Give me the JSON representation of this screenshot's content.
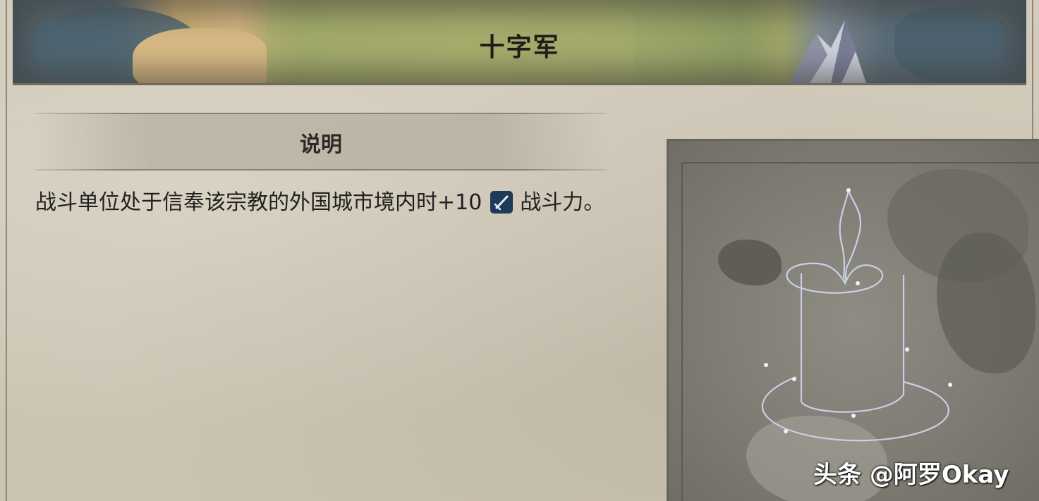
{
  "header": {
    "title": "十字军"
  },
  "section": {
    "title": "说明"
  },
  "description": {
    "text_before": "战斗单位处于信奉该宗教的外国城市境内时+10",
    "icon": "sword-icon",
    "text_after": "战斗力。"
  },
  "picture": {
    "icon": "candle-icon"
  },
  "watermark": {
    "text": "头条 @阿罗Okay"
  },
  "colors": {
    "parchment": "#cfc7b6",
    "ink": "#22211e",
    "badge": "#1f3a57",
    "candle_line": "#c9d0e6"
  }
}
